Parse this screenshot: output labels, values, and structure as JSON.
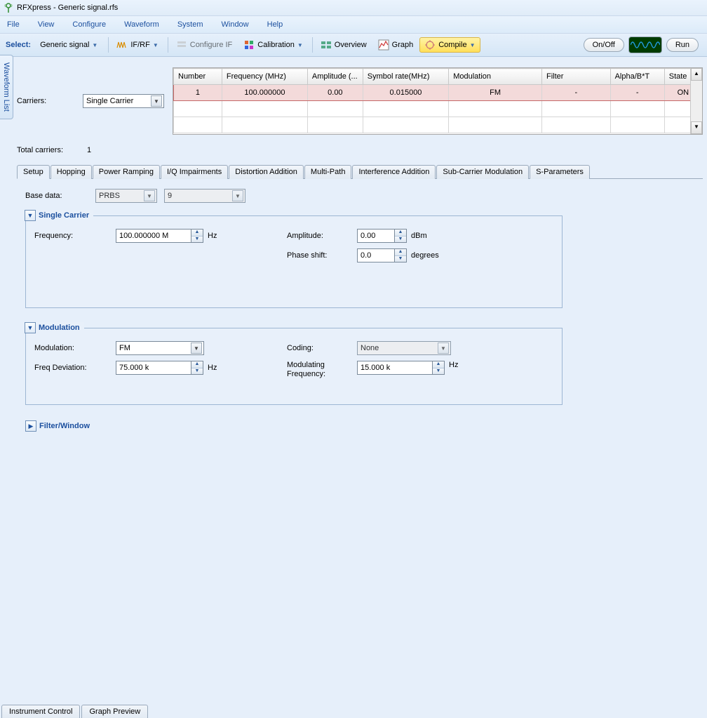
{
  "title": "RFXpress - Generic signal.rfs",
  "menu": [
    "File",
    "View",
    "Configure",
    "Waveform",
    "System",
    "Window",
    "Help"
  ],
  "toolbar": {
    "select_label": "Select:",
    "select_value": "Generic signal",
    "ifrf": "IF/RF",
    "configure_if": "Configure IF",
    "calibration": "Calibration",
    "overview": "Overview",
    "graph": "Graph",
    "compile": "Compile",
    "onoff": "On/Off",
    "run": "Run"
  },
  "rail": "Waveform List",
  "carriers": {
    "label": "Carriers:",
    "value": "Single Carrier",
    "total_label": "Total carriers:",
    "total_value": "1",
    "columns": [
      "Number",
      "Frequency (MHz)",
      "Amplitude (...",
      "Symbol rate(MHz)",
      "Modulation",
      "Filter",
      "Alpha/B*T",
      "State"
    ],
    "rows": [
      {
        "number": "1",
        "freq": "100.000000",
        "amp": "0.00",
        "sr": "0.015000",
        "mod": "FM",
        "filter": "-",
        "abt": "-",
        "state": "ON"
      }
    ]
  },
  "tabs": [
    "Setup",
    "Hopping",
    "Power Ramping",
    "I/Q Impairments",
    "Distortion Addition",
    "Multi-Path",
    "Interference Addition",
    "Sub-Carrier Modulation",
    "S-Parameters"
  ],
  "setup": {
    "base_data_label": "Base data:",
    "base_data_value": "PRBS",
    "base_data_param": "9",
    "single_carrier": {
      "title": "Single Carrier",
      "frequency_label": "Frequency:",
      "frequency_value": "100.000000 M",
      "frequency_unit": "Hz",
      "amplitude_label": "Amplitude:",
      "amplitude_value": "0.00",
      "amplitude_unit": "dBm",
      "phase_label": "Phase shift:",
      "phase_value": "0.0",
      "phase_unit": "degrees"
    },
    "modulation": {
      "title": "Modulation",
      "modulation_label": "Modulation:",
      "modulation_value": "FM",
      "coding_label": "Coding:",
      "coding_value": "None",
      "freqdev_label": "Freq Deviation:",
      "freqdev_value": "75.000 k",
      "freqdev_unit": "Hz",
      "modfreq_label": "Modulating Frequency:",
      "modfreq_value": "15.000 k",
      "modfreq_unit": "Hz"
    },
    "filter_title": "Filter/Window"
  },
  "bottom_tabs": [
    "Instrument Control",
    "Graph Preview"
  ]
}
